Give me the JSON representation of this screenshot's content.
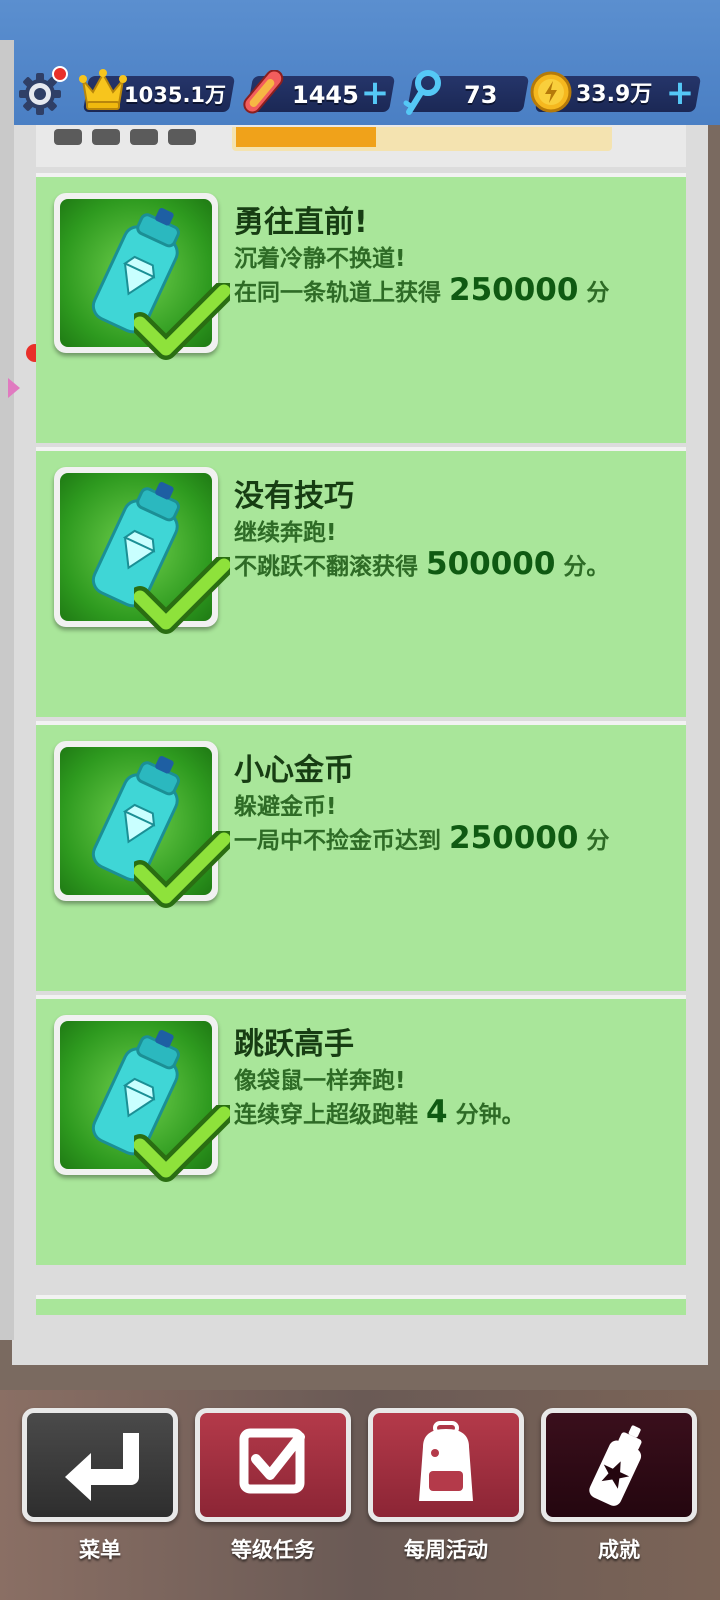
{
  "header": {
    "settings_icon": "gear-icon",
    "crown_icon": "crown-icon",
    "score": "1035.1万",
    "hoverboard_icon": "hoverboard-icon",
    "hoverboards": "1445",
    "key_icon": "key-icon",
    "keys": "73",
    "coin_icon": "coin-icon",
    "coins": "33.9万",
    "plus_label": "+"
  },
  "achievements": [
    {
      "title": "勇往直前!",
      "subtitle": "沉着冷静不换道!",
      "req_prefix": "在同一条轨道上获得",
      "req_value": "250000",
      "req_suffix": "分",
      "completed": true
    },
    {
      "title": "没有技巧",
      "subtitle": "继续奔跑!",
      "req_prefix": "不跳跃不翻滚获得",
      "req_value": "500000",
      "req_suffix": "分。",
      "completed": true
    },
    {
      "title": "小心金币",
      "subtitle": "躲避金币!",
      "req_prefix": " 一局中不捡金币达到",
      "req_value": "250000",
      "req_suffix": "分",
      "completed": true
    },
    {
      "title": "跳跃高手",
      "subtitle": "像袋鼠一样奔跑!",
      "req_prefix": "连续穿上超级跑鞋",
      "req_value": "4",
      "req_suffix": "分钟。",
      "completed": true
    }
  ],
  "nav": {
    "menu": "菜单",
    "level_tasks": "等级任务",
    "weekly": "每周活动",
    "achievements": "成就"
  },
  "colors": {
    "card_bg": "#a9e69a",
    "title_text": "#173d13",
    "value_text": "#0f5a12",
    "header_bg": "#4a7fc4",
    "plus": "#55c8f6"
  }
}
